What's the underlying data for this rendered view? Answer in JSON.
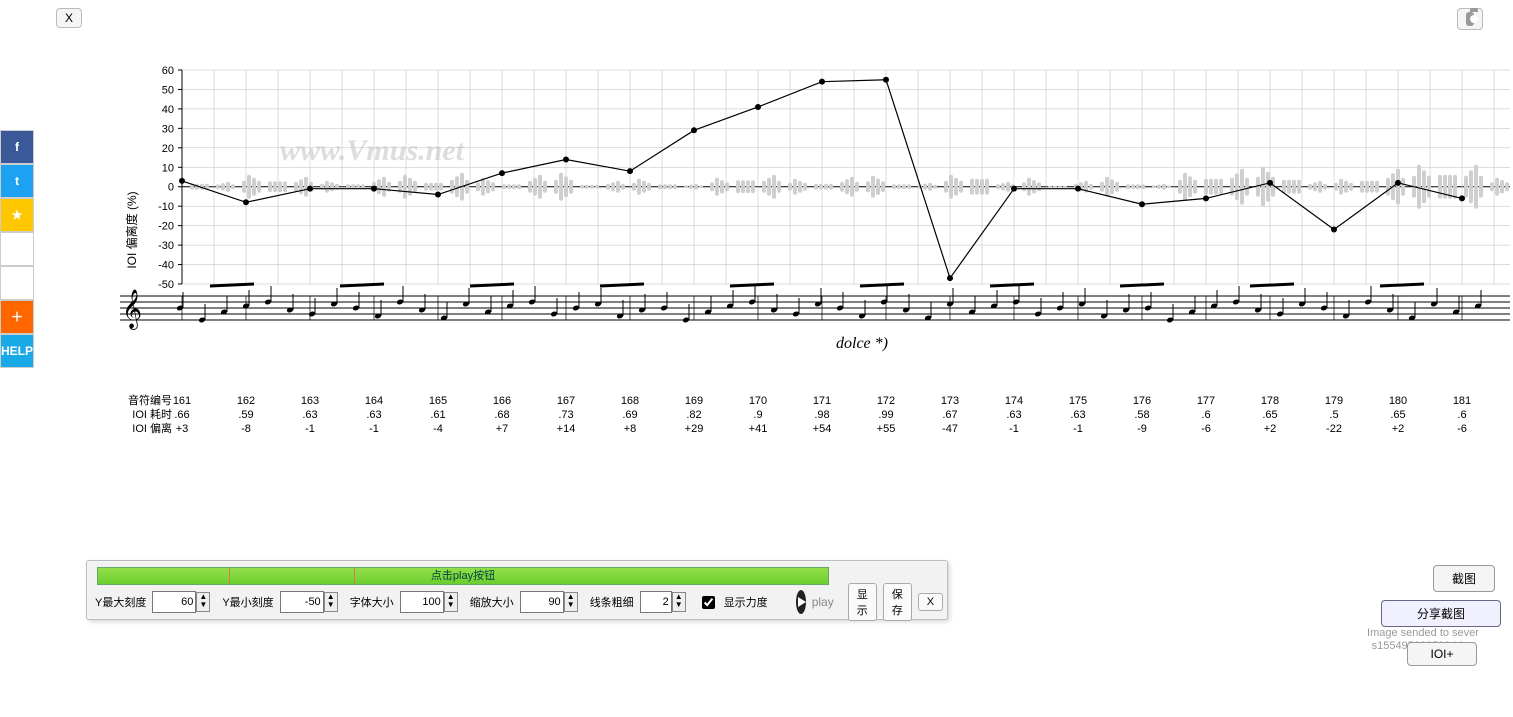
{
  "top": {
    "close": "X"
  },
  "watermark": "www.Vmus.net",
  "ylabel": "IOI 偏离度 (%)",
  "y_ticks": [
    60,
    50,
    40,
    30,
    20,
    10,
    0,
    -10,
    -20,
    -30,
    -40,
    -50
  ],
  "rows": {
    "note_no": "音符编号",
    "ioi_dur": "IOI 耗时",
    "ioi_dev": "IOI 偏离"
  },
  "score_annotation": "dolce *)",
  "chart_data": {
    "type": "line",
    "ylabel": "IOI 偏离度 (%)",
    "ylim": [
      -50,
      60
    ],
    "x_note_numbers": [
      161,
      162,
      163,
      164,
      165,
      166,
      167,
      168,
      169,
      170,
      171,
      172,
      173,
      174,
      175,
      176,
      177,
      178,
      179,
      180,
      181
    ],
    "ioi_duration": [
      ".66",
      ".59",
      ".63",
      ".63",
      ".61",
      ".68",
      ".73",
      ".69",
      ".82",
      ".9",
      ".98",
      ".99",
      ".67",
      ".63",
      ".63",
      ".58",
      ".6",
      ".65",
      ".5",
      ".65",
      ".6"
    ],
    "ioi_deviation": [
      "+3",
      "-8",
      "-1",
      "-1",
      "-4",
      "+7",
      "+14",
      "+8",
      "+29",
      "+41",
      "+54",
      "+55",
      "-47",
      "-1",
      "-1",
      "-9",
      "-6",
      "+2",
      "-22",
      "+2",
      "-6"
    ],
    "series": [
      {
        "name": "IOI deviation (%)",
        "x": [
          161,
          162,
          163,
          164,
          165,
          166,
          167,
          168,
          169,
          170,
          171,
          172,
          173,
          174,
          175,
          176,
          177,
          178,
          179,
          180,
          181
        ],
        "y": [
          3,
          -8,
          -1,
          -1,
          -4,
          7,
          14,
          8,
          29,
          41,
          54,
          55,
          -47,
          -1,
          -1,
          -9,
          -6,
          2,
          -22,
          2,
          -6
        ]
      }
    ]
  },
  "controls": {
    "play_hint": "点击play按钮",
    "ymax_lbl": "Y最大刻度",
    "ymax": "60",
    "ymin_lbl": "Y最小刻度",
    "ymin": "-50",
    "font_lbl": "字体大小",
    "font": "100",
    "zoom_lbl": "缩放大小",
    "zoom": "90",
    "lw_lbl": "线条粗细",
    "lw": "2",
    "show_dyn": "显示力度",
    "play": "play",
    "show": "显示",
    "save": "保存",
    "close": "X"
  },
  "right": {
    "capture": "截图",
    "share_capture": "分享截图",
    "status": "Image sended to sever\ns1554958925904.jpg",
    "ioi_plus": "IOI+"
  },
  "share_icons": [
    "f",
    "t",
    "★",
    "◉",
    "✉",
    "＋",
    "HELP"
  ]
}
